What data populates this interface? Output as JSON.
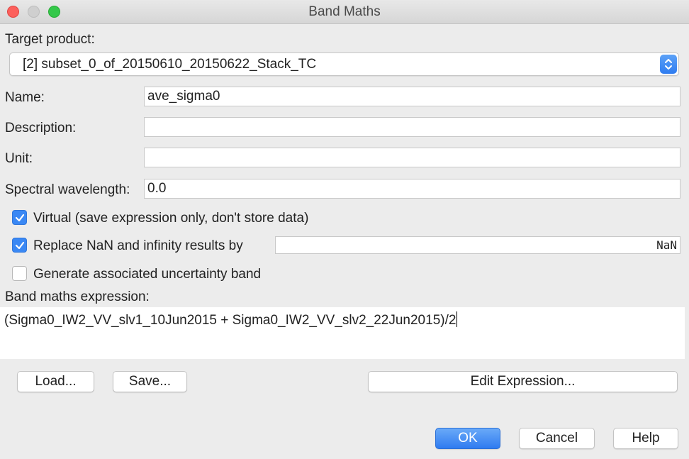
{
  "window": {
    "title": "Band Maths"
  },
  "target_product": {
    "label": "Target product:",
    "selected": "[2] subset_0_of_20150610_20150622_Stack_TC"
  },
  "name": {
    "label": "Name:",
    "value": "ave_sigma0"
  },
  "description": {
    "label": "Description:",
    "value": ""
  },
  "unit": {
    "label": "Unit:",
    "value": ""
  },
  "spectral_wavelength": {
    "label": "Spectral wavelength:",
    "value": "0.0"
  },
  "options": {
    "virtual": {
      "label": "Virtual (save expression only, don't store data)",
      "checked": true
    },
    "replace_nan": {
      "label": "Replace NaN and infinity results by",
      "checked": true,
      "value": "NaN"
    },
    "uncertainty": {
      "label": "Generate associated uncertainty band",
      "checked": false
    }
  },
  "expression": {
    "label": "Band maths expression:",
    "value": "(Sigma0_IW2_VV_slv1_10Jun2015 + Sigma0_IW2_VV_slv2_22Jun2015)/2"
  },
  "buttons": {
    "load": "Load...",
    "save": "Save...",
    "edit_expression": "Edit Expression...",
    "ok": "OK",
    "cancel": "Cancel",
    "help": "Help"
  },
  "colors": {
    "accent": "#3a88f4",
    "window_bg": "#ececec",
    "close": "#fc605c",
    "maximize": "#34c84a"
  }
}
